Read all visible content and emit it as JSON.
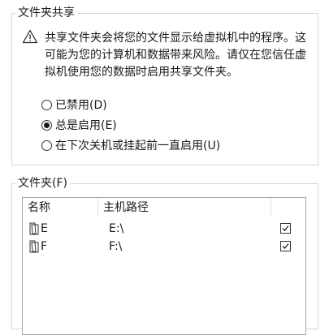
{
  "sharing_group": {
    "title": "文件夹共享",
    "warning_icon": "warning-triangle-icon",
    "warning_text": "共享文件夹会将您的文件显示给虚拟机中的程序。这可能为您的计算机和数据带来风险。请仅在您信任虚拟机使用您的数据时启用共享文件夹。",
    "options": [
      {
        "label": "已禁用(D)",
        "checked": false
      },
      {
        "label": "总是启用(E)",
        "checked": true
      },
      {
        "label": "在下次关机或挂起前一直启用(U)",
        "checked": false
      }
    ]
  },
  "folders_group": {
    "title": "文件夹(F)",
    "columns": {
      "name": "名称",
      "host_path": "主机路径"
    },
    "rows": [
      {
        "name": "E",
        "host_path": "E:\\",
        "enabled": true,
        "icon": "shared-folder-icon"
      },
      {
        "name": "F",
        "host_path": "F:\\",
        "enabled": true,
        "icon": "shared-folder-icon"
      }
    ]
  }
}
